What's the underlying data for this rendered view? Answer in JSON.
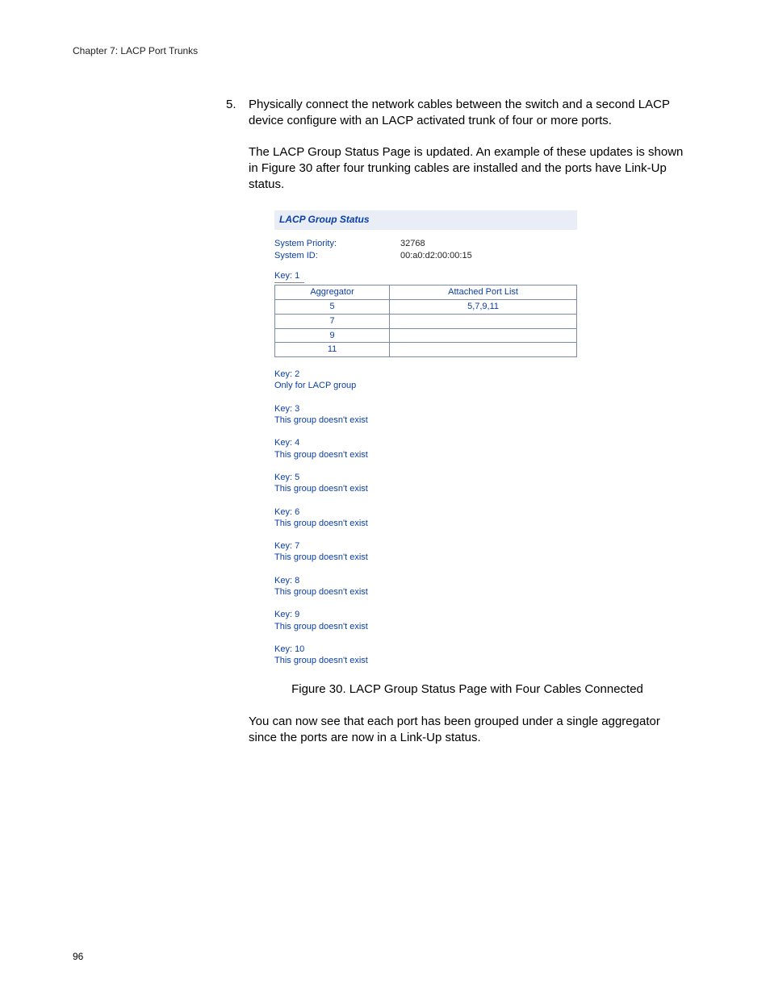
{
  "runningHead": "Chapter 7: LACP Port Trunks",
  "pageNumber": "96",
  "step": {
    "number": "5.",
    "text": "Physically connect the network cables between the switch and a second LACP device configure with an LACP activated trunk of four or more ports."
  },
  "para1": "The LACP Group Status Page is updated. An example of these updates is shown in Figure 30 after four trunking cables are installed and the ports have Link-Up status.",
  "figure": {
    "titleBar": "LACP Group Status",
    "sys": [
      {
        "label": "System Priority:",
        "value": "32768"
      },
      {
        "label": "System ID:",
        "value": "00:a0:d2:00:00:15"
      }
    ],
    "key1Label": "Key: 1",
    "tableHeaders": {
      "col1": "Aggregator",
      "col2": "Attached Port List"
    },
    "tableRows": [
      {
        "agg": "5",
        "ports": "5,7,9,11"
      },
      {
        "agg": "7",
        "ports": ""
      },
      {
        "agg": "9",
        "ports": ""
      },
      {
        "agg": "11",
        "ports": ""
      }
    ],
    "groups": [
      {
        "key": "Key: 2",
        "msg": "Only for LACP group"
      },
      {
        "key": "Key: 3",
        "msg": "This group doesn't exist"
      },
      {
        "key": "Key: 4",
        "msg": "This group doesn't exist"
      },
      {
        "key": "Key: 5",
        "msg": "This group doesn't exist"
      },
      {
        "key": "Key: 6",
        "msg": "This group doesn't exist"
      },
      {
        "key": "Key: 7",
        "msg": "This group doesn't exist"
      },
      {
        "key": "Key: 8",
        "msg": "This group doesn't exist"
      },
      {
        "key": "Key: 9",
        "msg": "This group doesn't exist"
      },
      {
        "key": "Key: 10",
        "msg": "This group doesn't exist"
      }
    ]
  },
  "figureCaption": "Figure 30. LACP Group Status Page with Four Cables Connected",
  "para2": "You can now see that each port has been grouped under a single aggregator since the ports are now in a Link-Up status."
}
